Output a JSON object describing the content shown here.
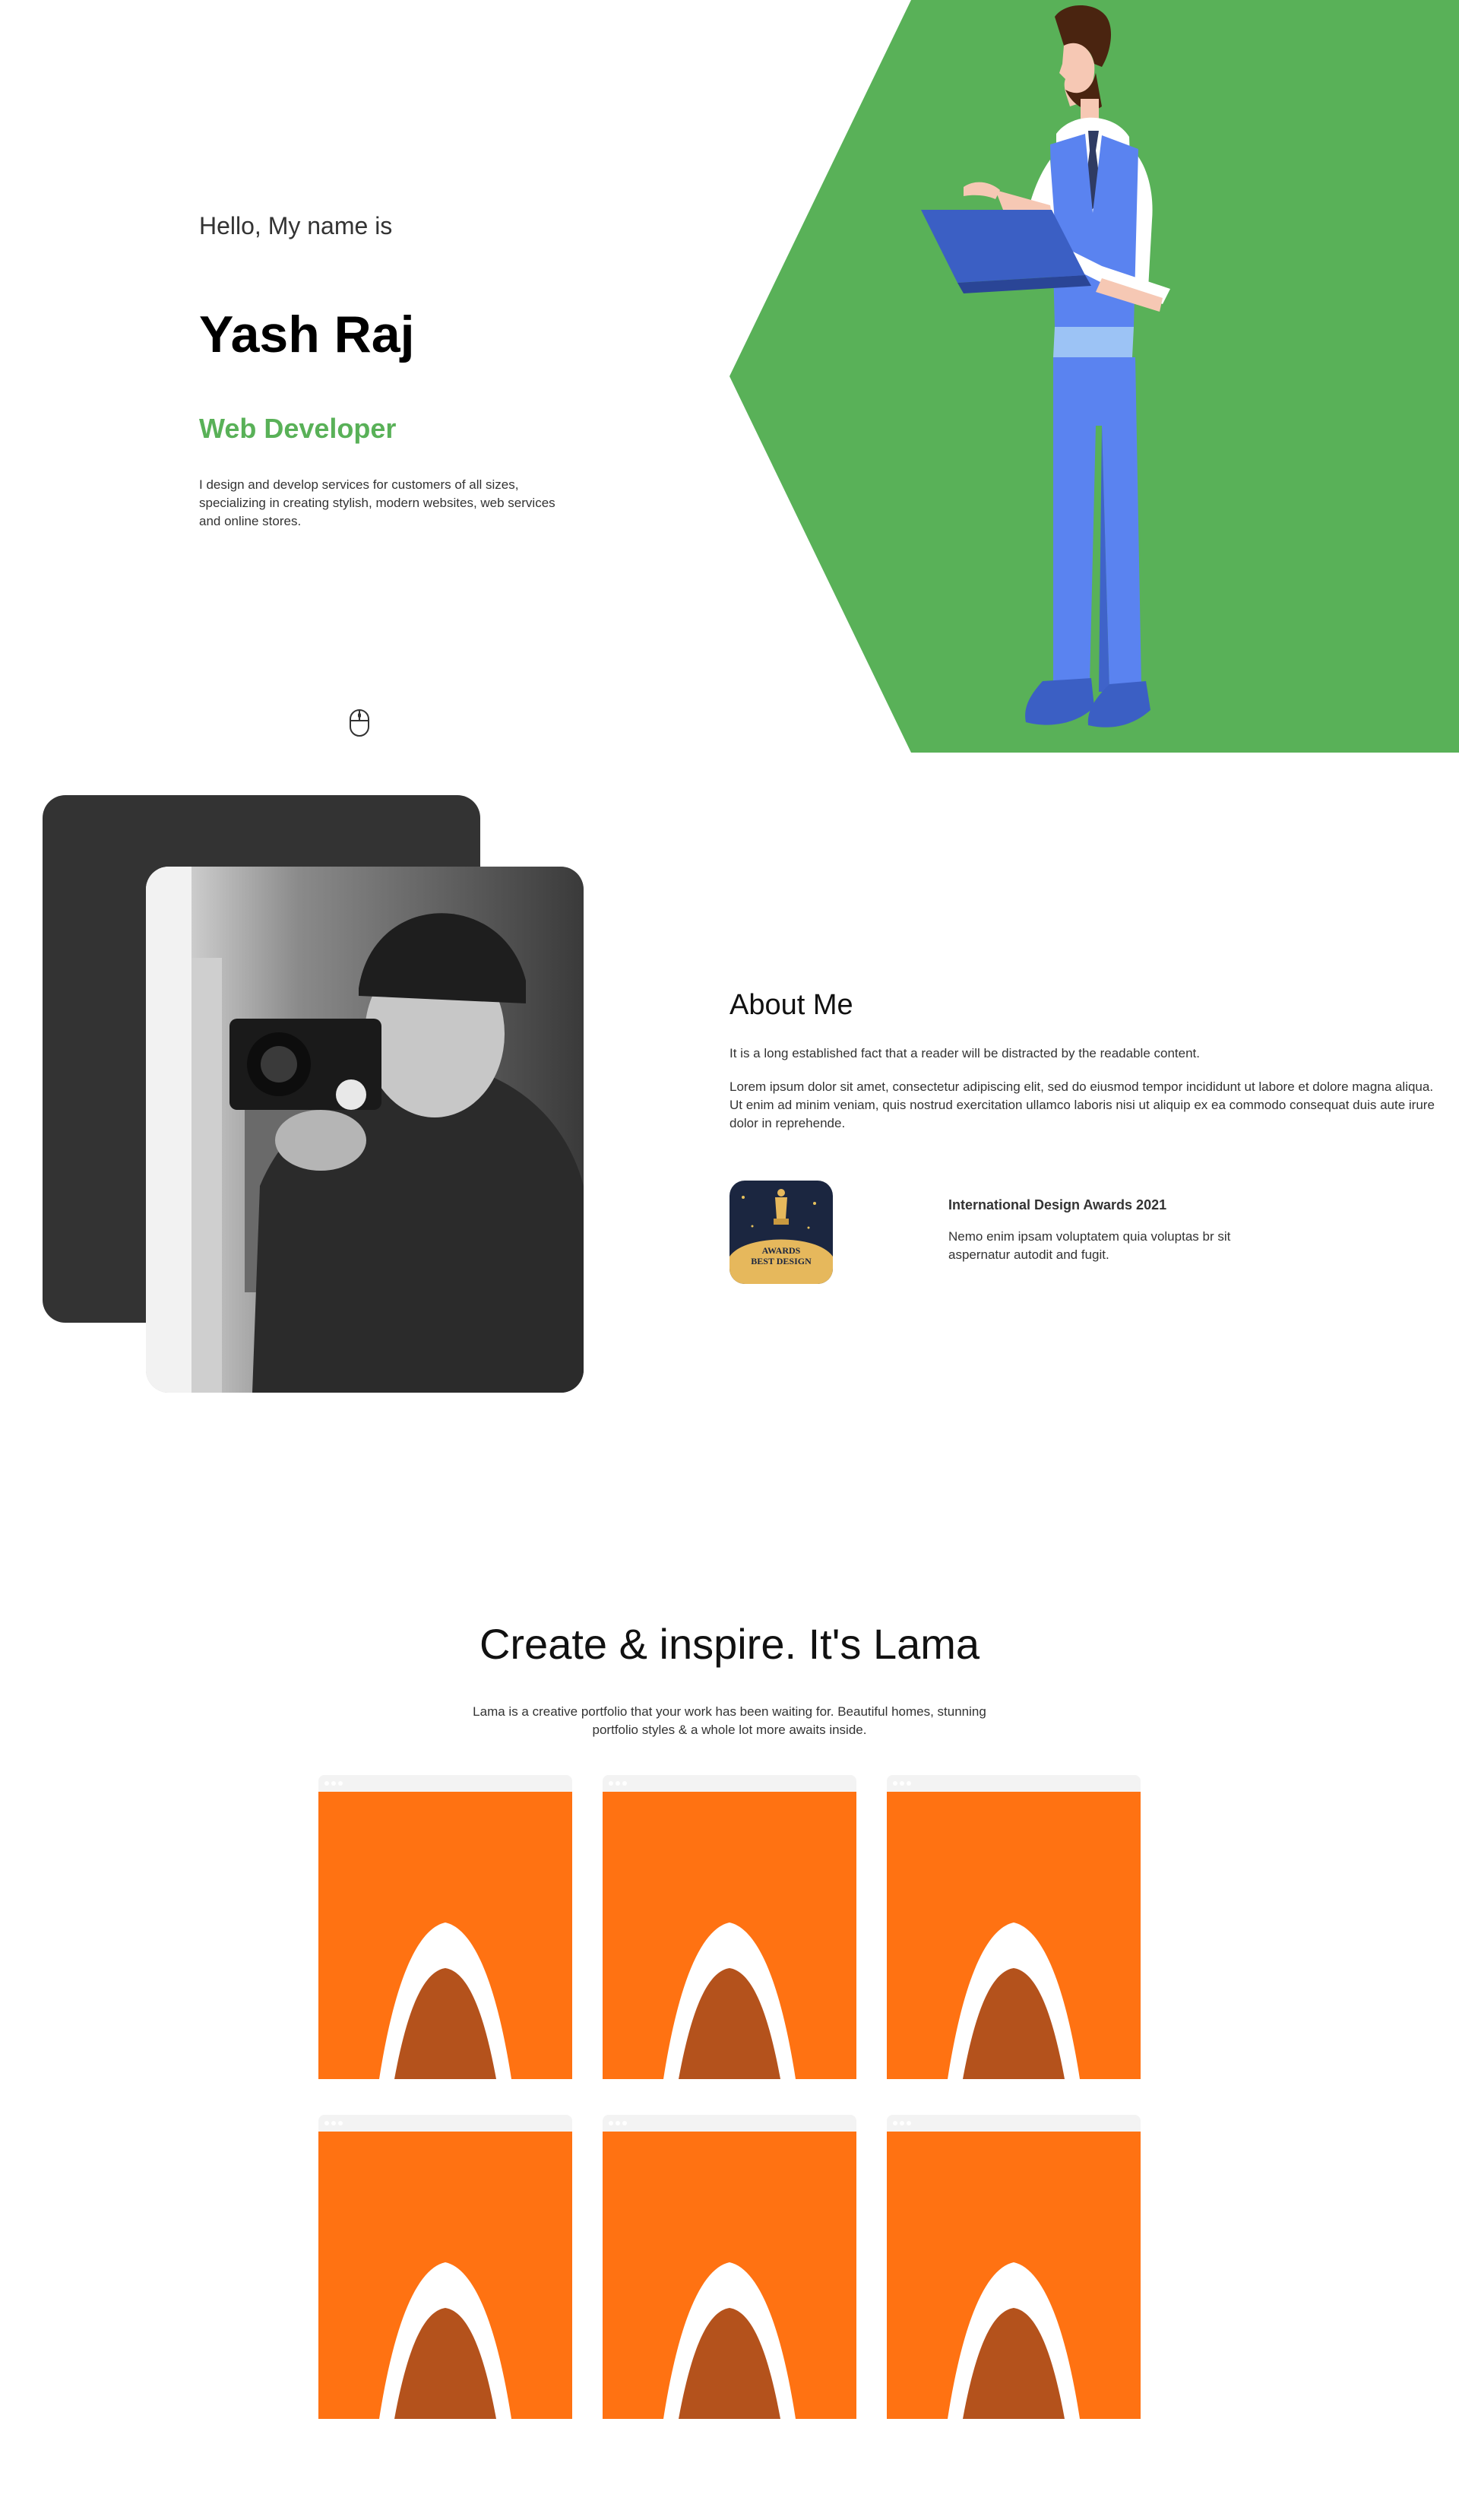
{
  "hero": {
    "intro": "Hello, My name is",
    "name": "Yash Raj",
    "role": "Web Developer",
    "description": "I design and develop services for customers of all sizes, specializing in creating stylish, modern websites, web services and online stores.",
    "scroll_icon": "mouse-scroll-icon",
    "accent_color": "#59b158"
  },
  "about": {
    "title": "About Me",
    "subtitle": "It is a long established fact that a reader will be distracted by the readable content.",
    "description": "Lorem ipsum dolor sit amet, consectetur adipiscing elit, sed do eiusmod tempor incididunt ut labore et dolore magna aliqua. Ut enim ad minim veniam, quis nostrud exercitation ullamco laboris nisi ut aliquip ex ea commodo consequat duis aute irure dolor in reprehende.",
    "award": {
      "badge_line1": "AWARDS",
      "badge_line2": "BEST DESIGN",
      "title": "International Design Awards 2021",
      "description": "Nemo enim ipsam voluptatem quia voluptas br sit aspernatur autodit and fugit."
    }
  },
  "products": {
    "title": "Create & inspire. It's Lama",
    "description": "Lama is a creative portfolio that your work has been waiting for. Beautiful homes, stunning portfolio styles & a whole lot more awaits inside.",
    "card_color": "#ff7212",
    "items": [
      "product-1",
      "product-2",
      "product-3",
      "product-4",
      "product-5",
      "product-6"
    ]
  }
}
